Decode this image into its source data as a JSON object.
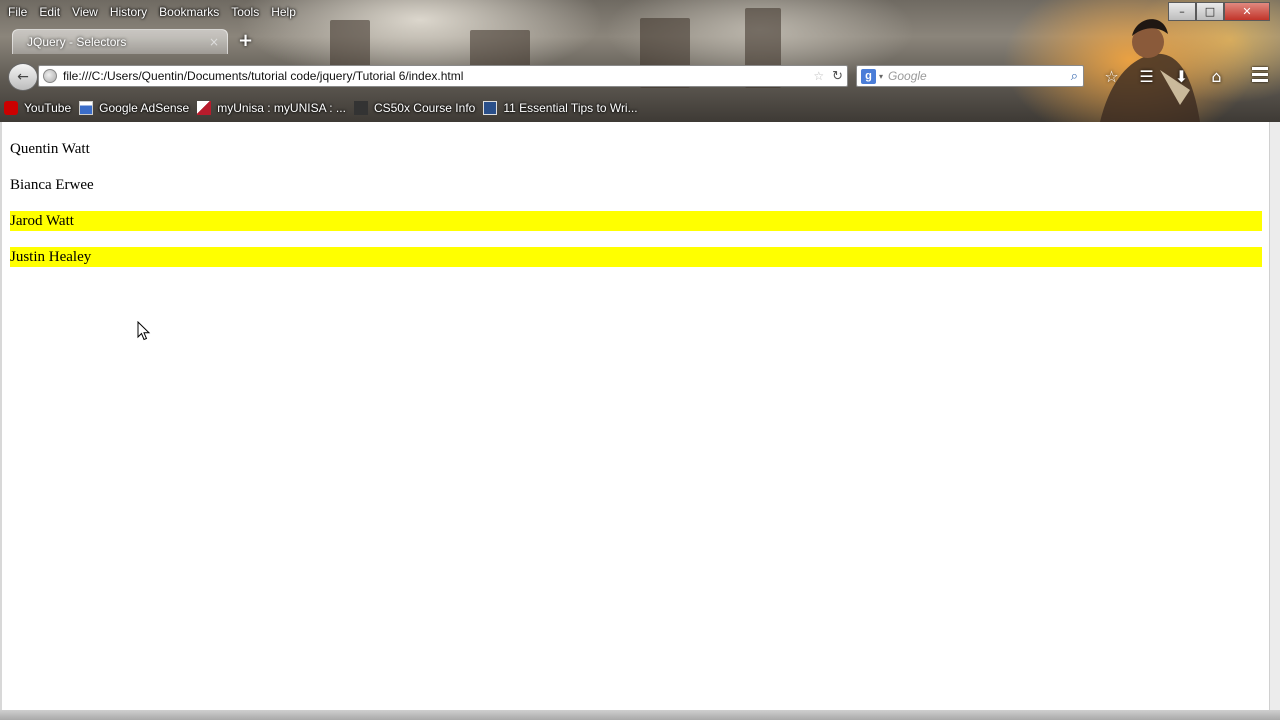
{
  "menubar": {
    "items": [
      "File",
      "Edit",
      "View",
      "History",
      "Bookmarks",
      "Tools",
      "Help"
    ]
  },
  "window_controls": {
    "minimize": "–",
    "maximize": "□",
    "close": "✕"
  },
  "tab": {
    "title": "JQuery - Selectors",
    "close": "×",
    "new_tab": "+"
  },
  "navbar": {
    "back": "←",
    "url": "file:///C:/Users/Quentin/Documents/tutorial code/jquery/Tutorial 6/index.html",
    "bookmark_star": "☆",
    "reload": "↻",
    "search_engine_letter": "g",
    "search_dropdown": "▾",
    "search_placeholder": "Google",
    "magnifier": "⌕",
    "icons": {
      "star": "☆",
      "reading_list": "☰",
      "download": "⬇",
      "home": "⌂"
    }
  },
  "bookmarks": [
    {
      "label": "YouTube",
      "icon": "youtube-icon",
      "color": "#cc0000"
    },
    {
      "label": "Google AdSense",
      "icon": "adsense-icon",
      "color": "#3b6dc9"
    },
    {
      "label": "myUnisa : myUNISA : ...",
      "icon": "unisa-icon",
      "color": "#b81c2c"
    },
    {
      "label": "CS50x Course Info",
      "icon": "cs50-icon",
      "color": "#333333"
    },
    {
      "label": "11 Essential Tips to Wri...",
      "icon": "article-icon",
      "color": "#2a4f8a"
    }
  ],
  "page": {
    "names": [
      {
        "text": "Quentin Watt",
        "highlighted": false
      },
      {
        "text": "Bianca Erwee",
        "highlighted": false
      },
      {
        "text": "Jarod Watt",
        "highlighted": true
      },
      {
        "text": "Justin Healey",
        "highlighted": true
      }
    ],
    "highlight_color": "#ffff00"
  }
}
